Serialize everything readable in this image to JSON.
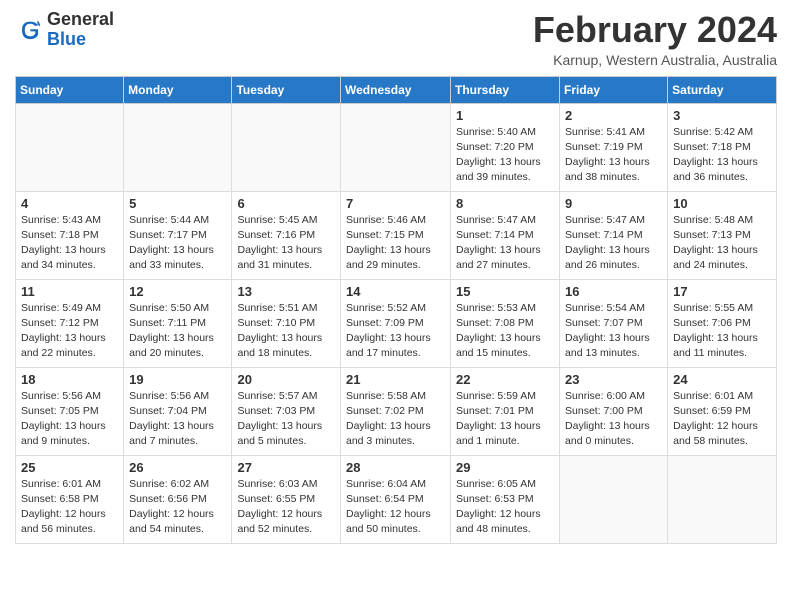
{
  "header": {
    "logo_general": "General",
    "logo_blue": "Blue",
    "month_title": "February 2024",
    "location": "Karnup, Western Australia, Australia"
  },
  "days_of_week": [
    "Sunday",
    "Monday",
    "Tuesday",
    "Wednesday",
    "Thursday",
    "Friday",
    "Saturday"
  ],
  "weeks": [
    [
      {
        "day": "",
        "detail": ""
      },
      {
        "day": "",
        "detail": ""
      },
      {
        "day": "",
        "detail": ""
      },
      {
        "day": "",
        "detail": ""
      },
      {
        "day": "1",
        "detail": "Sunrise: 5:40 AM\nSunset: 7:20 PM\nDaylight: 13 hours\nand 39 minutes."
      },
      {
        "day": "2",
        "detail": "Sunrise: 5:41 AM\nSunset: 7:19 PM\nDaylight: 13 hours\nand 38 minutes."
      },
      {
        "day": "3",
        "detail": "Sunrise: 5:42 AM\nSunset: 7:18 PM\nDaylight: 13 hours\nand 36 minutes."
      }
    ],
    [
      {
        "day": "4",
        "detail": "Sunrise: 5:43 AM\nSunset: 7:18 PM\nDaylight: 13 hours\nand 34 minutes."
      },
      {
        "day": "5",
        "detail": "Sunrise: 5:44 AM\nSunset: 7:17 PM\nDaylight: 13 hours\nand 33 minutes."
      },
      {
        "day": "6",
        "detail": "Sunrise: 5:45 AM\nSunset: 7:16 PM\nDaylight: 13 hours\nand 31 minutes."
      },
      {
        "day": "7",
        "detail": "Sunrise: 5:46 AM\nSunset: 7:15 PM\nDaylight: 13 hours\nand 29 minutes."
      },
      {
        "day": "8",
        "detail": "Sunrise: 5:47 AM\nSunset: 7:14 PM\nDaylight: 13 hours\nand 27 minutes."
      },
      {
        "day": "9",
        "detail": "Sunrise: 5:47 AM\nSunset: 7:14 PM\nDaylight: 13 hours\nand 26 minutes."
      },
      {
        "day": "10",
        "detail": "Sunrise: 5:48 AM\nSunset: 7:13 PM\nDaylight: 13 hours\nand 24 minutes."
      }
    ],
    [
      {
        "day": "11",
        "detail": "Sunrise: 5:49 AM\nSunset: 7:12 PM\nDaylight: 13 hours\nand 22 minutes."
      },
      {
        "day": "12",
        "detail": "Sunrise: 5:50 AM\nSunset: 7:11 PM\nDaylight: 13 hours\nand 20 minutes."
      },
      {
        "day": "13",
        "detail": "Sunrise: 5:51 AM\nSunset: 7:10 PM\nDaylight: 13 hours\nand 18 minutes."
      },
      {
        "day": "14",
        "detail": "Sunrise: 5:52 AM\nSunset: 7:09 PM\nDaylight: 13 hours\nand 17 minutes."
      },
      {
        "day": "15",
        "detail": "Sunrise: 5:53 AM\nSunset: 7:08 PM\nDaylight: 13 hours\nand 15 minutes."
      },
      {
        "day": "16",
        "detail": "Sunrise: 5:54 AM\nSunset: 7:07 PM\nDaylight: 13 hours\nand 13 minutes."
      },
      {
        "day": "17",
        "detail": "Sunrise: 5:55 AM\nSunset: 7:06 PM\nDaylight: 13 hours\nand 11 minutes."
      }
    ],
    [
      {
        "day": "18",
        "detail": "Sunrise: 5:56 AM\nSunset: 7:05 PM\nDaylight: 13 hours\nand 9 minutes."
      },
      {
        "day": "19",
        "detail": "Sunrise: 5:56 AM\nSunset: 7:04 PM\nDaylight: 13 hours\nand 7 minutes."
      },
      {
        "day": "20",
        "detail": "Sunrise: 5:57 AM\nSunset: 7:03 PM\nDaylight: 13 hours\nand 5 minutes."
      },
      {
        "day": "21",
        "detail": "Sunrise: 5:58 AM\nSunset: 7:02 PM\nDaylight: 13 hours\nand 3 minutes."
      },
      {
        "day": "22",
        "detail": "Sunrise: 5:59 AM\nSunset: 7:01 PM\nDaylight: 13 hours\nand 1 minute."
      },
      {
        "day": "23",
        "detail": "Sunrise: 6:00 AM\nSunset: 7:00 PM\nDaylight: 13 hours\nand 0 minutes."
      },
      {
        "day": "24",
        "detail": "Sunrise: 6:01 AM\nSunset: 6:59 PM\nDaylight: 12 hours\nand 58 minutes."
      }
    ],
    [
      {
        "day": "25",
        "detail": "Sunrise: 6:01 AM\nSunset: 6:58 PM\nDaylight: 12 hours\nand 56 minutes."
      },
      {
        "day": "26",
        "detail": "Sunrise: 6:02 AM\nSunset: 6:56 PM\nDaylight: 12 hours\nand 54 minutes."
      },
      {
        "day": "27",
        "detail": "Sunrise: 6:03 AM\nSunset: 6:55 PM\nDaylight: 12 hours\nand 52 minutes."
      },
      {
        "day": "28",
        "detail": "Sunrise: 6:04 AM\nSunset: 6:54 PM\nDaylight: 12 hours\nand 50 minutes."
      },
      {
        "day": "29",
        "detail": "Sunrise: 6:05 AM\nSunset: 6:53 PM\nDaylight: 12 hours\nand 48 minutes."
      },
      {
        "day": "",
        "detail": ""
      },
      {
        "day": "",
        "detail": ""
      }
    ]
  ]
}
